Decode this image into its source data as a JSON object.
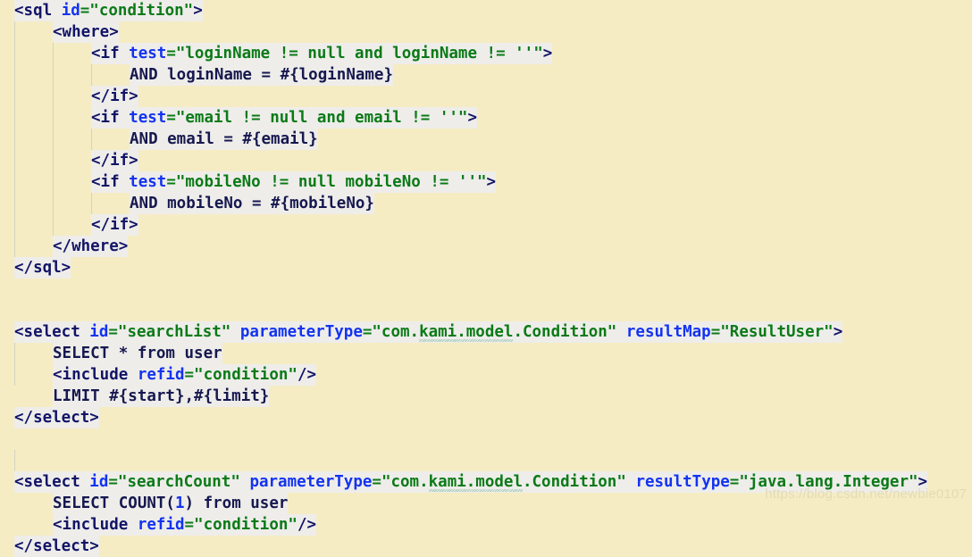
{
  "editor": {
    "background_color": "#f5ecc4",
    "highlight_color": "#eeedea",
    "guide_color": "#d6d2c0",
    "watermark": "https://blog.csdn.net/newbie0107",
    "colors": {
      "tag": "#121466",
      "attribute": "#1333f0",
      "string": "#0b7a17",
      "plain_sql": "#16184f",
      "number": "#1333f0",
      "spellcheck_squiggle": "#9ec9b4"
    }
  },
  "lines": {
    "l01": {
      "indent": 0,
      "t1": "<sql ",
      "t2": "id",
      "t3": "=\"condition\"",
      "t4": ">"
    },
    "l02": {
      "indent": 1,
      "t1": "<where>"
    },
    "l03": {
      "indent": 2,
      "t1": "<if ",
      "t2": "test",
      "t3": "=\"loginName != null and loginName != ''\"",
      "t4": ">"
    },
    "l04": {
      "indent": 3,
      "t1": "AND loginName = #{loginName}"
    },
    "l05": {
      "indent": 2,
      "t1": "</if>"
    },
    "l06": {
      "indent": 2,
      "t1": "<if ",
      "t2": "test",
      "t3": "=\"email != null and email != ''\"",
      "t4": ">"
    },
    "l07": {
      "indent": 3,
      "t1": "AND email = #{email}"
    },
    "l08": {
      "indent": 2,
      "t1": "</if>"
    },
    "l09": {
      "indent": 2,
      "t1": "<if ",
      "t2": "test",
      "t3": "=\"mobileNo != null mobileNo != ''\"",
      "t4": ">"
    },
    "l10": {
      "indent": 3,
      "t1": "AND mobileNo = #{mobileNo}"
    },
    "l11": {
      "indent": 2,
      "t1": "</if>"
    },
    "l12": {
      "indent": 1,
      "t1": "</where>"
    },
    "l13": {
      "indent": 0,
      "t1": "</sql>"
    },
    "l14": {
      "indent": 0,
      "t1": ""
    },
    "l15": {
      "indent": 0,
      "t1": "<select ",
      "t2": "id",
      "t3": "=\"searchList\"",
      "t4": " ",
      "t5": "parameterType",
      "t6": "=\"com.",
      "t7": "kami.model",
      "t8": ".Condition\"",
      "t9": " ",
      "t10": "resultMap",
      "t11": "=\"ResultUser\"",
      "t12": ">"
    },
    "l16": {
      "indent": 1,
      "t1": "SELECT * from user"
    },
    "l17": {
      "indent": 1,
      "t1": "<include ",
      "t2": "refid",
      "t3": "=\"condition\"",
      "t4": "/>"
    },
    "l18": {
      "indent": 1,
      "t1": "LIMIT #{start},#{limit}"
    },
    "l19": {
      "indent": 0,
      "t1": "</select>"
    },
    "l20": {
      "indent": 0,
      "t1": ""
    },
    "l21": {
      "indent": 0,
      "t1": "<select ",
      "t2": "id",
      "t3": "=\"searchCount\"",
      "t4": " ",
      "t5": "parameterType",
      "t6": "=\"com.",
      "t7": "kami.model",
      "t8": ".Condition\"",
      "t9": " ",
      "t10": "resultType",
      "t11": "=\"java.lang.Integer\"",
      "t12": ">"
    },
    "l22": {
      "indent": 1,
      "t1": "SELECT COUNT(",
      "t2": "1",
      "t3": ") from user"
    },
    "l23": {
      "indent": 1,
      "t1": "<include ",
      "t2": "refid",
      "t3": "=\"condition\"",
      "t4": "/>"
    },
    "l24": {
      "indent": 0,
      "t1": "</select>"
    }
  }
}
